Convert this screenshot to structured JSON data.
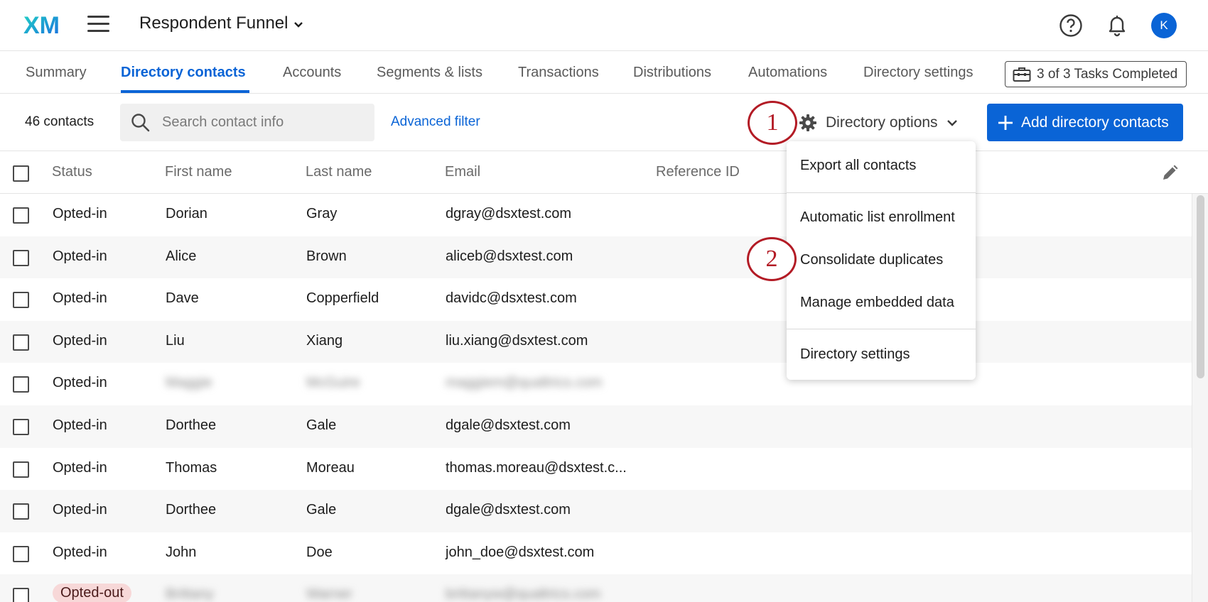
{
  "header": {
    "logo_text": "XM",
    "project_name": "Respondent Funnel",
    "avatar_initial": "K",
    "accent_color": "#0a64d6"
  },
  "tabs": [
    {
      "label": "Summary",
      "active": false
    },
    {
      "label": "Directory contacts",
      "active": true
    },
    {
      "label": "Accounts",
      "active": false
    },
    {
      "label": "Segments & lists",
      "active": false
    },
    {
      "label": "Transactions",
      "active": false
    },
    {
      "label": "Distributions",
      "active": false
    },
    {
      "label": "Automations",
      "active": false
    },
    {
      "label": "Directory settings",
      "active": false
    }
  ],
  "tasks_label": "3 of 3 Tasks Completed",
  "toolbar": {
    "contact_count": "46 contacts",
    "search_placeholder": "Search contact info",
    "advanced_filter": "Advanced filter",
    "directory_options": "Directory options",
    "add_button": "Add directory contacts"
  },
  "callouts": [
    "1",
    "2"
  ],
  "columns": [
    "Status",
    "First name",
    "Last name",
    "Email",
    "Reference ID"
  ],
  "rows": [
    {
      "status": "Opted-in",
      "first": "Dorian",
      "last": "Gray",
      "email": "dgray@dsxtest.com",
      "blurred": false
    },
    {
      "status": "Opted-in",
      "first": "Alice",
      "last": "Brown",
      "email": "aliceb@dsxtest.com",
      "blurred": false
    },
    {
      "status": "Opted-in",
      "first": "Dave",
      "last": "Copperfield",
      "email": "davidc@dsxtest.com",
      "blurred": false
    },
    {
      "status": "Opted-in",
      "first": "Liu",
      "last": "Xiang",
      "email": "liu.xiang@dsxtest.com",
      "blurred": false
    },
    {
      "status": "Opted-in",
      "first": "Maggie",
      "last": "McGuire",
      "email": "maggiem@qualtrics.com",
      "blurred": true
    },
    {
      "status": "Opted-in",
      "first": "Dorthee",
      "last": "Gale",
      "email": "dgale@dsxtest.com",
      "blurred": false
    },
    {
      "status": "Opted-in",
      "first": "Thomas",
      "last": "Moreau",
      "email": "thomas.moreau@dsxtest.c...",
      "blurred": false
    },
    {
      "status": "Opted-in",
      "first": "Dorthee",
      "last": "Gale",
      "email": "dgale@dsxtest.com",
      "blurred": false
    },
    {
      "status": "Opted-in",
      "first": "John",
      "last": "Doe",
      "email": "john_doe@dsxtest.com",
      "blurred": false
    },
    {
      "status": "Opted-out",
      "first": "Brittany",
      "last": "Warner",
      "email": "brittanyw@qualtrics.com",
      "blurred": true
    }
  ],
  "dropdown": {
    "items": [
      "Export all contacts",
      "Automatic list enrollment",
      "Consolidate duplicates",
      "Manage embedded data",
      "Directory settings"
    ]
  }
}
